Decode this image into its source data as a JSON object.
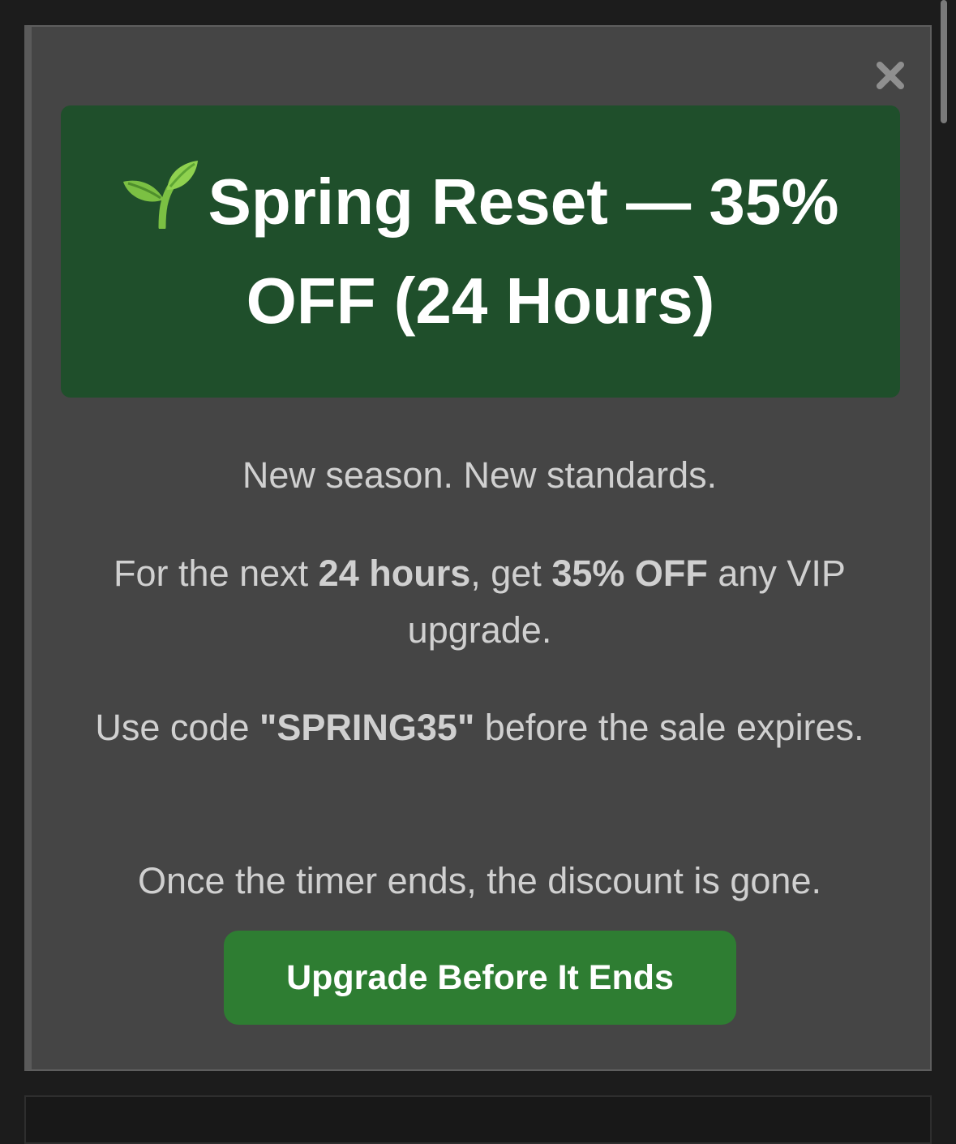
{
  "modal": {
    "close_label": "×",
    "title": "Spring Reset — 35% OFF (24 Hours)",
    "paragraphs": {
      "p1": "New season. New standards.",
      "p2": {
        "a": "For the next ",
        "b": "24 hours",
        "c": ", get ",
        "d": "35% OFF",
        "e": " any VIP upgrade."
      },
      "p3": {
        "a": "Use code ",
        "b": "\"SPRING35\"",
        "c": " before the sale expires."
      },
      "p4": "Once the timer ends, the discount is gone."
    },
    "cta_label": "Upgrade Before It Ends"
  },
  "icons": {
    "title_icon": "sprout-icon",
    "close_icon": "close-icon"
  },
  "colors": {
    "banner": "#1f4f2b",
    "cta": "#2e7d32",
    "modal_bg": "#454545",
    "page_bg": "#1c1c1c"
  }
}
